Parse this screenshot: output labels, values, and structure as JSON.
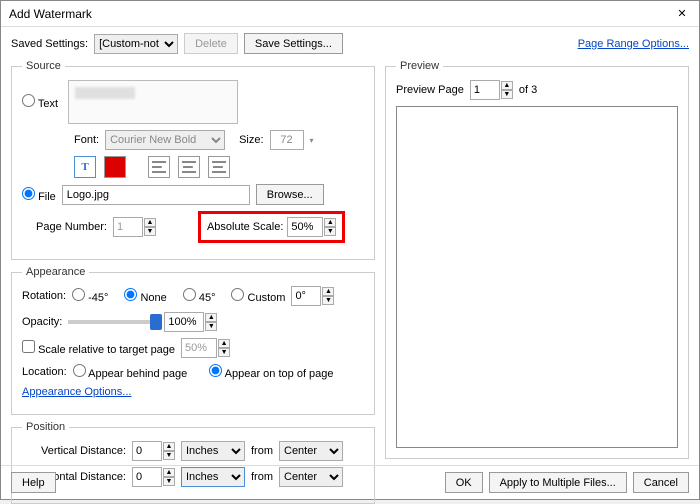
{
  "title": "Add Watermark",
  "close_glyph": "✕",
  "saved": {
    "label": "Saved Settings:",
    "value": "[Custom-not saved]",
    "delete": "Delete",
    "save": "Save Settings..."
  },
  "page_range_link": "Page Range Options...",
  "source": {
    "legend": "Source",
    "text_label": "Text",
    "font_label": "Font:",
    "font_value": "Courier New Bold",
    "size_label": "Size:",
    "size_value": "72",
    "file_label": "File",
    "file_value": "Logo.jpg",
    "browse": "Browse...",
    "page_number_label": "Page Number:",
    "page_number_value": "1",
    "abs_scale_label": "Absolute Scale:",
    "abs_scale_value": "50%"
  },
  "appearance": {
    "legend": "Appearance",
    "rotation_label": "Rotation:",
    "rot_m45": "-45°",
    "rot_none": "None",
    "rot_45": "45°",
    "rot_custom": "Custom",
    "rot_value": "0°",
    "opacity_label": "Opacity:",
    "opacity_value": "100%",
    "scale_rel_label": "Scale relative to target page",
    "scale_rel_value": "50%",
    "location_label": "Location:",
    "behind": "Appear behind page",
    "ontop": "Appear on top of page",
    "options_link": "Appearance Options..."
  },
  "position": {
    "legend": "Position",
    "vdist_label": "Vertical Distance:",
    "vdist_value": "0",
    "vdist_unit": "Inches",
    "from": "from",
    "vdist_from": "Center",
    "hdist_label": "Horizontal Distance:",
    "hdist_value": "0",
    "hdist_unit": "Inches",
    "hdist_from": "Center"
  },
  "preview": {
    "legend": "Preview",
    "page_label": "Preview Page",
    "page_value": "1",
    "of_label": "of 3"
  },
  "footer": {
    "help": "Help",
    "ok": "OK",
    "apply": "Apply to Multiple Files...",
    "cancel": "Cancel"
  }
}
